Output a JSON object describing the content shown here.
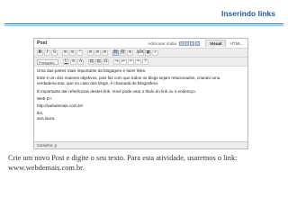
{
  "slide": {
    "title": "Inserindo links",
    "caption_line1": "Crie um novo Post e digite o seu texto. Para esta atividade, usaremos o link:",
    "caption_line2": "www.webdemais.com.br."
  },
  "editor": {
    "post_label": "Post",
    "adicionar_midia": "Adicionar mídia",
    "tabs": [
      "Visual",
      "HTML"
    ],
    "format_select": "Parágrafo",
    "toolbar1": [
      "B",
      "I",
      "S",
      "≡",
      "≡",
      "“",
      "≡",
      "≡",
      "≡",
      "⛓",
      "⛓",
      "≡",
      "ABC",
      "▦",
      "✓"
    ],
    "toolbar2": [
      "U",
      "≡",
      "A",
      "▤",
      "▤",
      "Ω",
      "⇥",
      "⇤",
      "↶",
      "↷",
      "?"
    ],
    "content": {
      "p1": "Uma das partes mais importante da blogagem é fazer links.",
      "p2a": "Este é um dos maiores objetivos, pois faz com que todos os blogs sejam relacionados, criando uma",
      "p2b": "verdadeira teia, que no caso dos blogs, é chamada de Blogosfera.",
      "p3": "É importante dar referências destes link. Você pode usar o título do link ou o endereço.",
      "p4": "Web D+",
      "p5": "http://webdemais.com.br/",
      "p6": "tks,",
      "p7": "ana laura"
    },
    "status": "Caminho: p"
  }
}
